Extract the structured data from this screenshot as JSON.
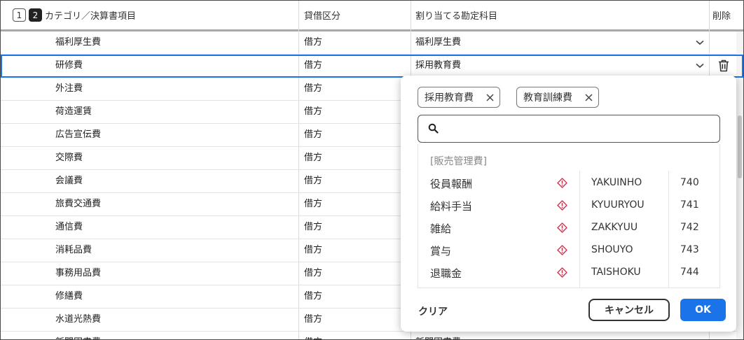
{
  "header": {
    "level_1": "1",
    "level_2": "2",
    "category_label": "カテゴリ／決算書項目",
    "side_label": "貸借区分",
    "account_label": "割り当てる勘定科目",
    "delete_label": "削除"
  },
  "rows": [
    {
      "name": "福利厚生費",
      "side": "借方",
      "account": "福利厚生費"
    },
    {
      "name": "研修費",
      "side": "借方",
      "account": "採用教育費"
    },
    {
      "name": "外注費",
      "side": "借方",
      "account": ""
    },
    {
      "name": "荷造運賃",
      "side": "借方",
      "account": ""
    },
    {
      "name": "広告宣伝費",
      "side": "借方",
      "account": ""
    },
    {
      "name": "交際費",
      "side": "借方",
      "account": ""
    },
    {
      "name": "会議費",
      "side": "借方",
      "account": ""
    },
    {
      "name": "旅費交通費",
      "side": "借方",
      "account": ""
    },
    {
      "name": "通信費",
      "side": "借方",
      "account": ""
    },
    {
      "name": "消耗品費",
      "side": "借方",
      "account": ""
    },
    {
      "name": "事務用品費",
      "side": "借方",
      "account": ""
    },
    {
      "name": "修繕費",
      "side": "借方",
      "account": ""
    },
    {
      "name": "水道光熱費",
      "side": "借方",
      "account": ""
    },
    {
      "name": "新聞図書費",
      "side": "借方",
      "account": "新聞図書費"
    }
  ],
  "popup": {
    "chips": [
      {
        "label": "採用教育費"
      },
      {
        "label": "教育訓練費"
      }
    ],
    "search": {
      "value": "",
      "placeholder": ""
    },
    "group_label": "[販売管理費]",
    "items": [
      {
        "name": "役員報酬",
        "code": "YAKUINHO",
        "number": "740"
      },
      {
        "name": "給料手当",
        "code": "KYUURYOU",
        "number": "741"
      },
      {
        "name": "雑給",
        "code": "ZAKKYUU",
        "number": "742"
      },
      {
        "name": "賞与",
        "code": "SHOUYO",
        "number": "743"
      },
      {
        "name": "退職金",
        "code": "TAISHOKU",
        "number": "744"
      }
    ],
    "clear_label": "クリア",
    "cancel_label": "キャンセル",
    "ok_label": "OK"
  },
  "colors": {
    "accent": "#1a73e8",
    "warning_icon": "#d0324b",
    "header_rule": "#a9a9a9"
  },
  "icons": {
    "row_dropdown": "chevron-down-icon",
    "row_delete": "trash-icon",
    "chip_remove": "close-icon",
    "search": "search-icon",
    "item_warning": "warning-diamond-icon"
  }
}
